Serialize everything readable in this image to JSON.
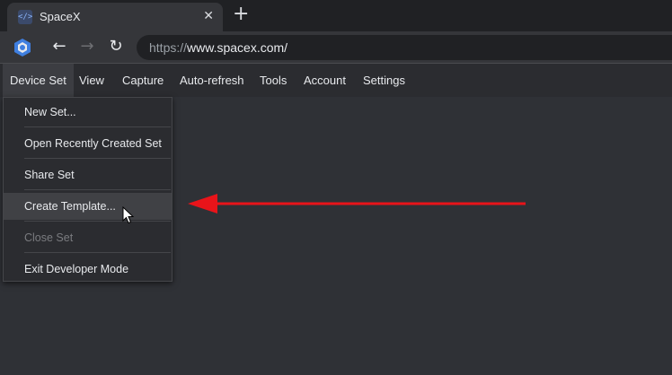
{
  "browser": {
    "tab": {
      "title": "SpaceX",
      "favicon": "code-icon",
      "close_symbol": "✕"
    },
    "new_tab_symbol": "+",
    "nav": {
      "back": "←",
      "forward": "→",
      "reload": "↻"
    },
    "url": {
      "scheme": "https://",
      "host_path": "www.spacex.com/"
    }
  },
  "menubar": {
    "items": [
      "Device Set",
      "View",
      "Capture",
      "Auto-refresh",
      "Tools",
      "Account",
      "Settings"
    ],
    "active_index": 0
  },
  "dropdown": {
    "items": [
      {
        "label": "New Set...",
        "state": "normal"
      },
      {
        "label": "Open Recently Created Set",
        "state": "normal"
      },
      {
        "label": "Share Set",
        "state": "normal"
      },
      {
        "label": "Create Template...",
        "state": "hover"
      },
      {
        "label": "Close Set",
        "state": "disabled"
      },
      {
        "label": "Exit Developer Mode",
        "state": "normal"
      }
    ]
  },
  "annotation": {
    "arrow_color": "#e8141a"
  },
  "colors": {
    "background": "#2f3136",
    "menubar": "#2b2c30",
    "accent": "#8ab4f8"
  }
}
